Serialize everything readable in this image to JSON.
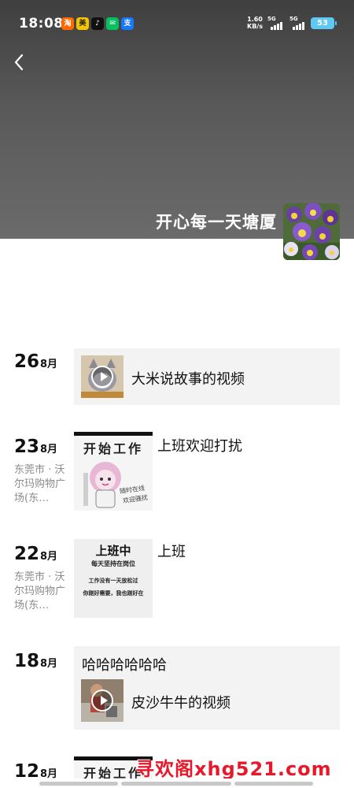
{
  "status_bar": {
    "time": "18:08",
    "net_speed_value": "1.60",
    "net_speed_unit": "KB/s",
    "sim1": "5G",
    "sim2": "5G",
    "battery": "53"
  },
  "header": {
    "back_icon": "chevron-left-icon",
    "user_name": "开心每一天塘厦"
  },
  "posts": [
    {
      "day": "26",
      "month": "8月",
      "location": "",
      "type": "video-share",
      "title": "大米说故事的视频",
      "text": ""
    },
    {
      "day": "23",
      "month": "8月",
      "location": "东莞市 · 沃尔玛购物广场(东…",
      "type": "image",
      "text": "上班欢迎打扰",
      "image_text": {
        "line1": "开始工作",
        "line2": "随时在线",
        "line3": "欢迎骚扰"
      }
    },
    {
      "day": "22",
      "month": "8月",
      "location": "东莞市 · 沃尔玛购物广场(东…",
      "type": "image",
      "text": "上班",
      "image_text": {
        "line1": "上班中",
        "line2": "每天坚持在岗位",
        "line3": "工作没有一天放松过",
        "line4": "你刚好需要，我也刚好在"
      }
    },
    {
      "day": "18",
      "month": "8月",
      "location": "",
      "type": "text-video",
      "text": "哈哈哈哈哈哈",
      "title": "皮沙牛牛的视频"
    },
    {
      "day": "12",
      "month": "8月",
      "location": "",
      "type": "image",
      "text": "",
      "image_text": {
        "line1": "开始工作"
      }
    }
  ],
  "watermark": "寻欢阁xhg521.com",
  "colors": {
    "cover": "#595959",
    "card": "#f3f3f3",
    "location": "#8a8a8a",
    "watermark": "#e8182b",
    "battery": "#5fc8f2"
  }
}
